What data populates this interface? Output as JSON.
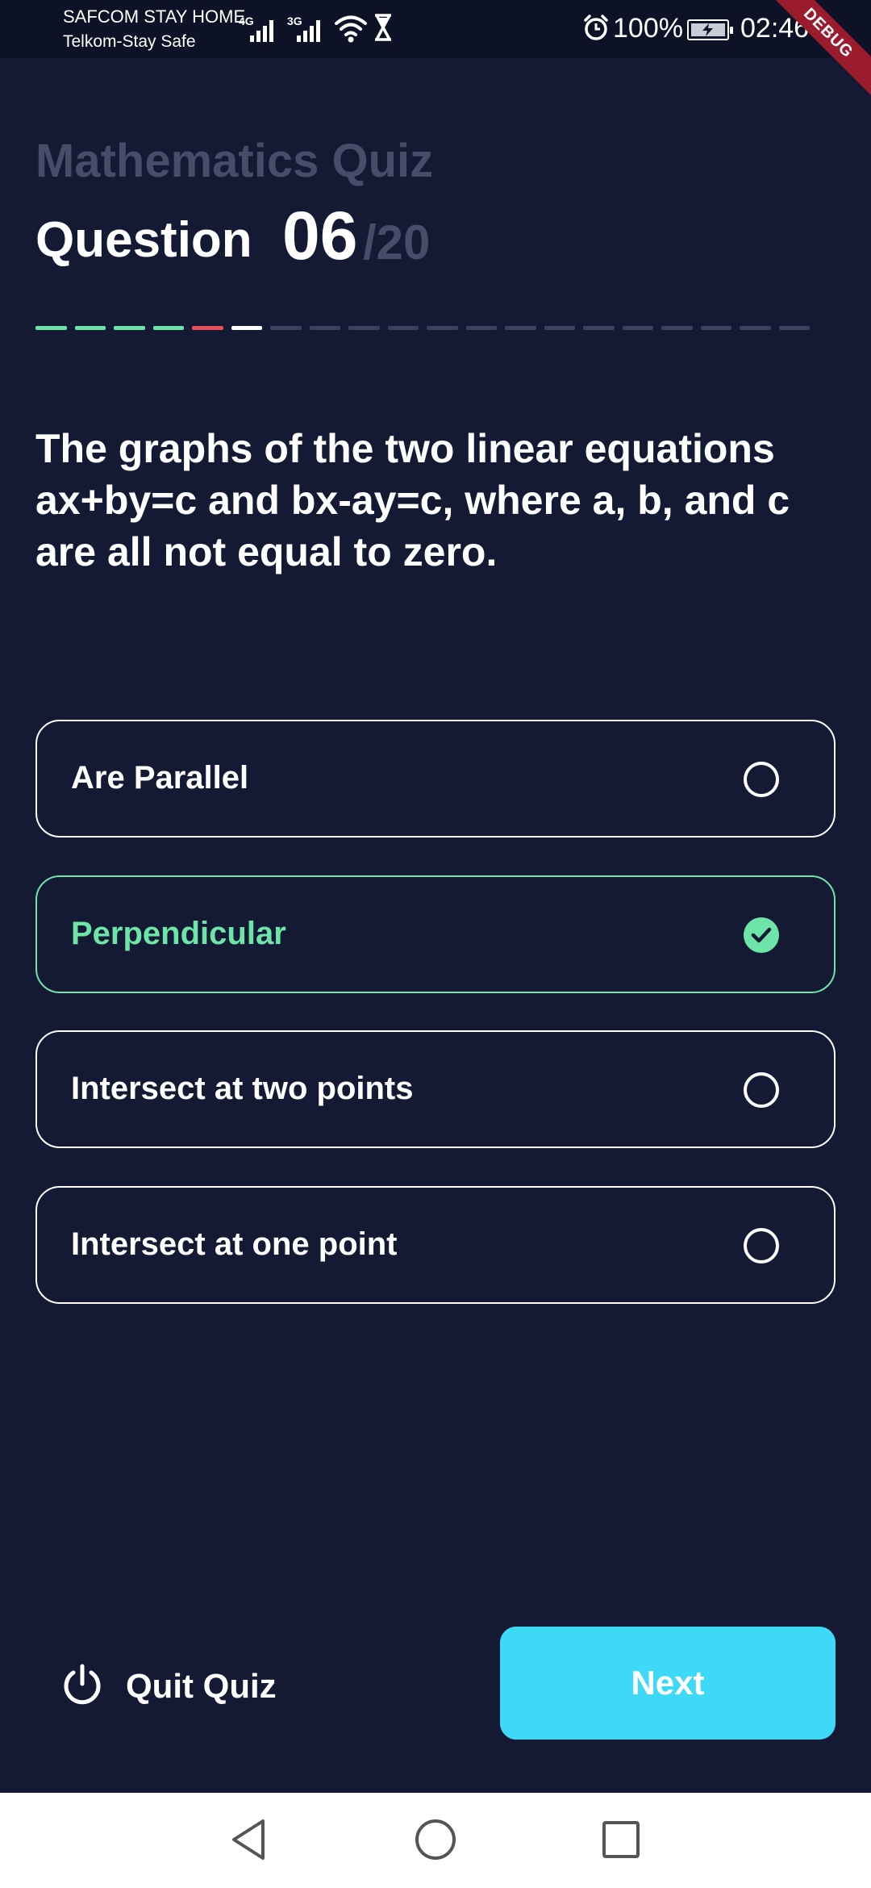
{
  "status_bar": {
    "carrier_1": "SAFCOM STAY HOME",
    "net_1": "4G",
    "carrier_2": "Telkom-Stay Safe",
    "net_2": "3G",
    "battery": "100%",
    "time": "02:46",
    "icons": [
      "signal-icon",
      "wifi-icon",
      "hourglass-icon",
      "alarm-icon",
      "battery-charging-icon"
    ]
  },
  "debug_banner": "DEBUG",
  "header": {
    "title": "Mathematics Quiz",
    "question_label": "Question",
    "question_number": "06",
    "question_total": "/20"
  },
  "progress": {
    "total": 20,
    "current": 6,
    "segments": [
      "correct",
      "correct",
      "correct",
      "correct",
      "wrong",
      "current",
      "pending",
      "pending",
      "pending",
      "pending",
      "pending",
      "pending",
      "pending",
      "pending",
      "pending",
      "pending",
      "pending",
      "pending",
      "pending",
      "pending"
    ],
    "colors": {
      "correct": "#6de4a8",
      "wrong": "#e84f5c",
      "current": "#ffffff",
      "pending": "#3a4260"
    }
  },
  "question": {
    "text": "The graphs of the two linear equations ax+by=c and bx-ay=c, where a, b, and c are all not equal to zero."
  },
  "options": [
    {
      "label": "Are Parallel",
      "selected": false
    },
    {
      "label": "Perpendicular",
      "selected": true
    },
    {
      "label": "Intersect at two points",
      "selected": false
    },
    {
      "label": "Intersect at one point",
      "selected": false
    }
  ],
  "footer": {
    "quit_label": "Quit Quiz",
    "next_label": "Next"
  },
  "colors": {
    "background": "#141a33",
    "accent_green": "#6de4a8",
    "accent_cyan": "#3ed9f7",
    "muted": "#454d69",
    "debug_red": "#9b1c2c"
  }
}
